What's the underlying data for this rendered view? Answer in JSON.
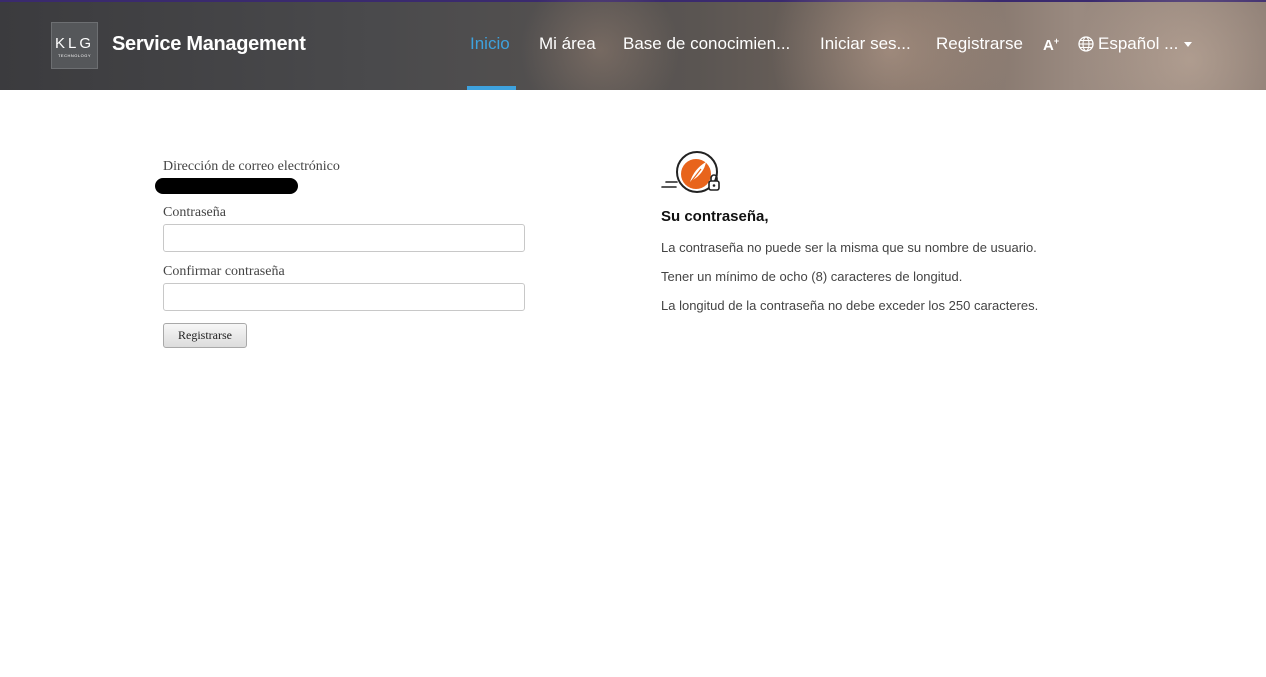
{
  "header": {
    "logo": {
      "mark": "KLG",
      "sub": "TECHNOLOGY"
    },
    "brand": "Service Management",
    "nav": [
      {
        "label": "Inicio",
        "active": true
      },
      {
        "label": "Mi área"
      },
      {
        "label": "Base de conocimien..."
      },
      {
        "label": "Iniciar ses..."
      },
      {
        "label": "Registrarse"
      }
    ],
    "accessibility_label": "A",
    "accessibility_icon": "font-size-icon",
    "language": "Español ...",
    "language_icon": "globe-icon",
    "accent_color": "#3ea2de"
  },
  "form": {
    "email_label": "Dirección de correo electrónico",
    "password_label": "Contraseña",
    "password_value": "",
    "confirm_label": "Confirmar contraseña",
    "confirm_value": "",
    "submit_label": "Registrarse"
  },
  "info": {
    "icon": "password-lock-icon",
    "title": "Su contraseña,",
    "rules": [
      "La contraseña no puede ser la misma que su nombre de usuario.",
      "Tener un mínimo de ocho (8) caracteres de longitud.",
      "La longitud de la contraseña no debe exceder los 250 caracteres."
    ],
    "icon_color": "#e8641c"
  }
}
